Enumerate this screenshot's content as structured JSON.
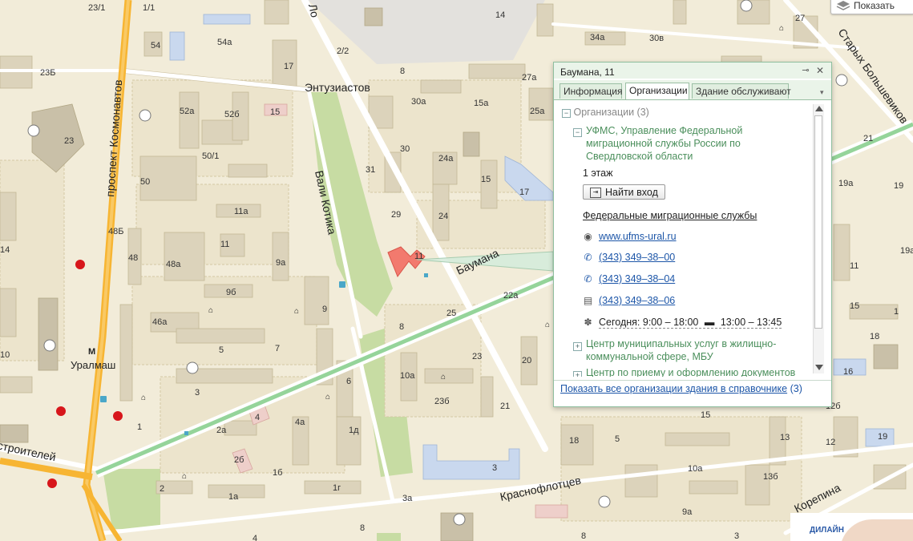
{
  "colors": {
    "ground": "#f2ecd9",
    "block": "#ece4cc",
    "building": "#dcd3bb",
    "building_dark": "#c9c0a8",
    "highway": "#f7b533",
    "road": "#ffffff",
    "park": "#c7dca3",
    "tram": "#95d49a",
    "highlight": "#f27a6e",
    "school": "#c9d8ee",
    "popup_accent": "#4b8f5c",
    "link": "#1d56a8",
    "metro": "#d7161b"
  },
  "map": {
    "streets": [
      {
        "id": "kosmonavtov",
        "label": "проспект Космонавтов"
      },
      {
        "id": "entuziastov",
        "label": "Энтузиастов"
      },
      {
        "id": "kotika",
        "label": "Вали Котика"
      },
      {
        "id": "baumana",
        "label": "Баумана"
      },
      {
        "id": "krasnoflotcev",
        "label": "Краснофлотцев"
      },
      {
        "id": "korepina",
        "label": "Корепина"
      },
      {
        "id": "bolshevikov",
        "label": "Старых Большевиков"
      },
      {
        "id": "stroiteley",
        "label": "строителей"
      },
      {
        "id": "l",
        "label": "Ло"
      }
    ],
    "metro_station": "Уралмаш",
    "metro_letter": "М",
    "house_numbers": [
      "23/1",
      "1/1",
      "23Б",
      "54",
      "54а",
      "17",
      "2/2",
      "14",
      "34а",
      "30в",
      "27",
      "15",
      "52а",
      "52б",
      "50/1",
      "50",
      "23",
      "8",
      "27а",
      "30а",
      "15а",
      "25а",
      "30",
      "24а",
      "15",
      "17",
      "31",
      "29",
      "24",
      "19а",
      "19",
      "11а",
      "11",
      "48Б",
      "48",
      "48а",
      "9а",
      "9б",
      "46а",
      "9",
      "5",
      "7",
      "3",
      "1",
      "14",
      "10",
      "11",
      "25",
      "8",
      "23",
      "10а",
      "23б",
      "21",
      "20",
      "6",
      "4",
      "4а",
      "2а",
      "2б",
      "1б",
      "1д",
      "1г",
      "2",
      "1а",
      "3",
      "3а",
      "4",
      "8",
      "22а",
      "18",
      "5",
      "15",
      "13",
      "12",
      "19",
      "16",
      "10а",
      "13б",
      "9а",
      "15",
      "11",
      "1",
      "3",
      "8",
      "18",
      "12б",
      "21",
      "19а"
    ],
    "highlight_number": "11"
  },
  "layer_control": {
    "label": "Показать",
    "icon": "layers-icon"
  },
  "popup": {
    "title": "Баумана, 11",
    "tabs": [
      {
        "label": "Информация",
        "active": false
      },
      {
        "label": "Организации",
        "active": true
      },
      {
        "label": "Здание обслуживают",
        "active": false
      }
    ],
    "group_header": "Организации (3)",
    "org1": {
      "name_lines": [
        "УФМС, Управление Федеральной",
        "миграционной службы России по",
        "Свердловской области"
      ],
      "floor": "1 этаж",
      "enter_button": "Найти вход",
      "category": "Федеральные миграционные службы",
      "website": "www.ufms-ural.ru",
      "phones": [
        "(343) 349–38–00",
        "(343) 349–38–04"
      ],
      "fax": "(343) 349–38–06",
      "hours_today": "Сегодня:",
      "hours": "9:00 – 18:00",
      "break": "13:00 – 13:45"
    },
    "org2_lines": [
      "Центр муниципальных услуг в жилищно-",
      "коммунальной сфере, МБУ"
    ],
    "org3_line": "Центр по приему и оформлению документов",
    "footer_link": "Показать все организации здания в справочнике",
    "footer_count": "(3)"
  },
  "ad": {
    "brand": "ДИЛАЙН"
  }
}
